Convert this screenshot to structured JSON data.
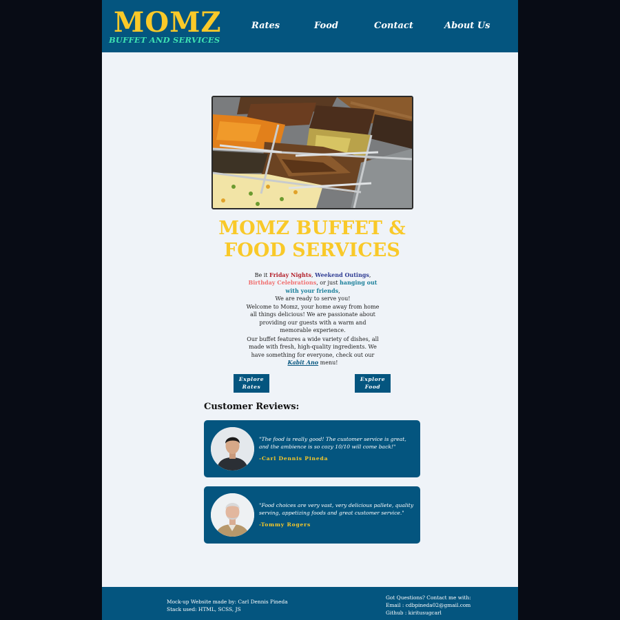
{
  "header": {
    "logo_title": "MOMZ",
    "logo_subtitle": "BUFFET AND SERVICES",
    "nav": [
      "Rates",
      "Food",
      "Contact",
      "About Us"
    ]
  },
  "hero": {
    "image_alt": "buffet-food-trays-photo",
    "title_line1": "MOMZ BUFFET &",
    "title_line2": "FOOD SERVICES"
  },
  "intro": {
    "p1_prefix": "Be it ",
    "p1_friday": "Friday Nights",
    "p1_sep1": ", ",
    "p1_weekend": "Weekend Outings",
    "p1_sep2": ", ",
    "p1_birthday": "Birthday Celebrations",
    "p1_sep3": ", or just ",
    "p1_hanging": "hanging out with your friends",
    "p1_suffix": ",",
    "p1_line2": "We are ready to serve you!",
    "p2": "Welcome to Momz, your home away from home all things delicious! We are passionate about providing our guests with a warm and memorable experience.",
    "p3_prefix": "Our buffet features a wide variety of dishes, all made with fresh, high-quality ingredients. We have something for everyone, check out our ",
    "p3_link": "Kabit Ano",
    "p3_suffix": " menu!"
  },
  "buttons": {
    "explore_rates": "Explore\nRates",
    "explore_food": "Explore\nFood"
  },
  "reviews": {
    "heading": "Customer Reviews:",
    "items": [
      {
        "quote": "\"The food is really good! The customer service is great, and the ambience is so cozy 10/10 will come back!\"",
        "author": "-Carl Dennis Pineda"
      },
      {
        "quote": "\"Food choices are very vast, very delicious pallete, quality serving, appetizing foods and great customer service.\"",
        "author": "-Tommy Rogers"
      }
    ]
  },
  "footer": {
    "left_line1": "Mock-up Website made by: Carl Dennis Pineda",
    "left_line2": "Stack used: HTML, SCSS, JS",
    "right_line1": "Got Questions? Contact me with:",
    "right_line2": "Email : cdbpineda02@gmail.com",
    "right_line3": "Github : kiritusugcarl"
  },
  "colors": {
    "brand_blue": "#04557f",
    "accent_yellow": "#f9c929",
    "accent_mint": "#3ee0b1",
    "page_bg": "#eff3f8"
  }
}
